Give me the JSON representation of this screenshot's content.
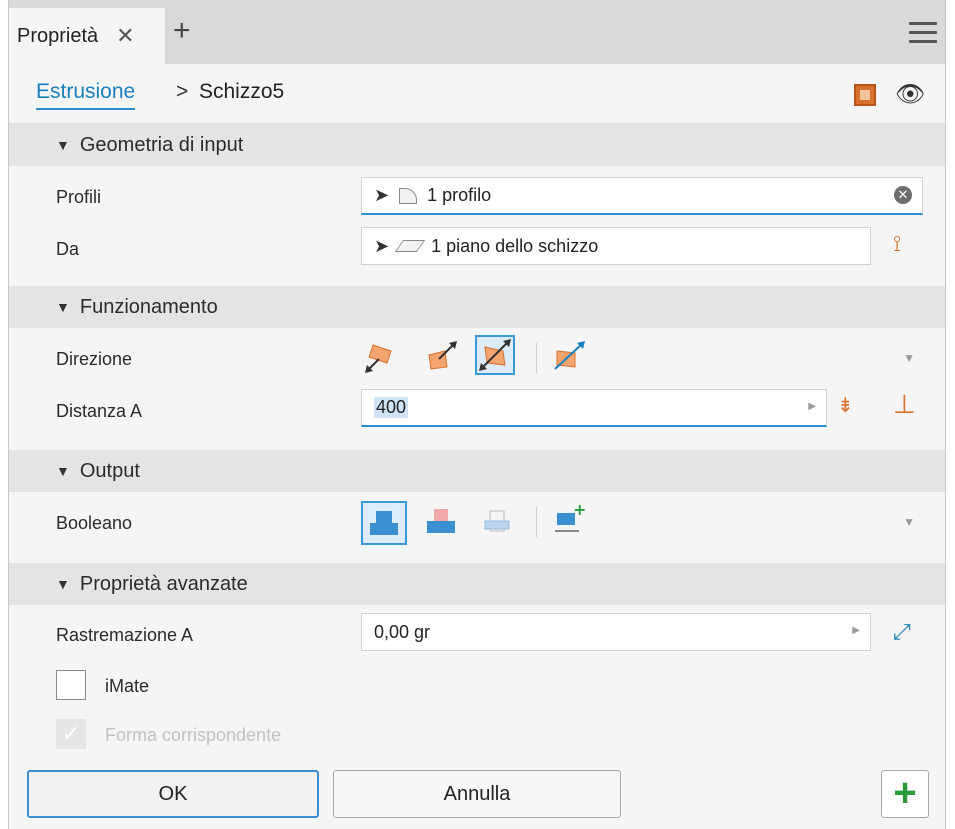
{
  "tab": {
    "title": "Proprietà",
    "close_glyph": "✕",
    "add_glyph": "+"
  },
  "breadcrumb": {
    "link": "Estrusione",
    "separator": ">",
    "current": "Schizzo5"
  },
  "sections": {
    "input": "Geometria di input",
    "behavior": "Funzionamento",
    "output": "Output",
    "advanced": "Proprietà avanzate"
  },
  "fields": {
    "profiles": {
      "label": "Profili",
      "value": "1 profilo"
    },
    "from": {
      "label": "Da",
      "value": "1 piano dello schizzo"
    },
    "direction": {
      "label": "Direzione"
    },
    "distance": {
      "label": "Distanza A",
      "value": "400"
    },
    "boolean": {
      "label": "Booleano"
    },
    "taper": {
      "label": "Rastremazione A",
      "value": "0,00 gr"
    },
    "imate": {
      "label": "iMate",
      "checked": false
    },
    "match_shape": {
      "label": "Forma corrispondente",
      "checked": true,
      "disabled": true
    }
  },
  "buttons": {
    "ok": "OK",
    "cancel": "Annulla",
    "add": "+"
  },
  "colors": {
    "accent": "#2b8ecc",
    "orange": "#d9712e",
    "green": "#2a9a3a"
  }
}
